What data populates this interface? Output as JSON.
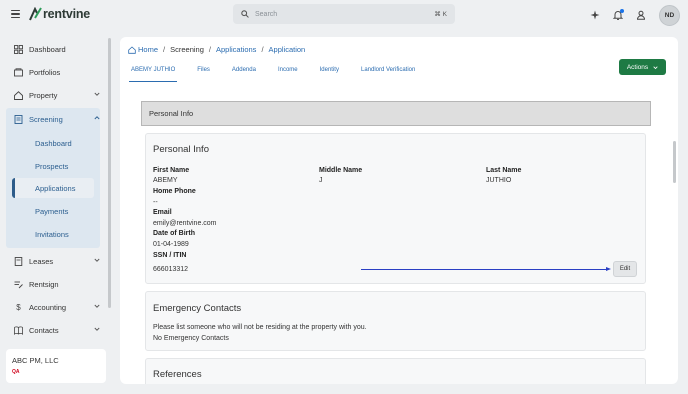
{
  "app": {
    "brand": "rentvine",
    "brand_color": "#2d3a35",
    "accent_color": "#2b6cb0",
    "primary_button_color": "#1e7a44"
  },
  "search": {
    "placeholder": "Search",
    "shortcut": "⌘ K"
  },
  "user": {
    "initials": "ND"
  },
  "sidebar": {
    "items": [
      {
        "label": "Dashboard",
        "icon": "dashboard-icon"
      },
      {
        "label": "Portfolios",
        "icon": "portfolio-icon"
      },
      {
        "label": "Property",
        "icon": "property-icon"
      },
      {
        "label": "Screening",
        "icon": "screening-icon"
      },
      {
        "label": "Leases",
        "icon": "lease-icon"
      },
      {
        "label": "Rentsign",
        "icon": "rentsign-icon"
      },
      {
        "label": "Accounting",
        "icon": "dollar-icon"
      },
      {
        "label": "Contacts",
        "icon": "contacts-icon"
      }
    ],
    "screening_sub": [
      "Dashboard",
      "Prospects",
      "Applications",
      "Payments",
      "Invitations"
    ],
    "active_sub": "Applications"
  },
  "company": {
    "name": "ABC PM, LLC",
    "tag": "QA"
  },
  "breadcrumb": {
    "home": "Home",
    "screening": "Screening",
    "applications": "Applications",
    "application": "Application"
  },
  "tabs": [
    "ABEMY JUTHIO",
    "Files",
    "Addenda",
    "Income",
    "Identity",
    "Landlord Verification"
  ],
  "actions_label": "Actions",
  "section_header": "Personal Info",
  "personal_info": {
    "title": "Personal Info",
    "first_name_label": "First Name",
    "first_name": "ABEMY",
    "middle_name_label": "Middle Name",
    "middle_name": "J",
    "last_name_label": "Last Name",
    "last_name": "JUTHIO",
    "home_phone_label": "Home Phone",
    "home_phone": "--",
    "email_label": "Email",
    "email": "emily@rentvine.com",
    "dob_label": "Date of Birth",
    "dob": "01-04-1989",
    "ssn_label": "SSN / ITIN",
    "ssn": "666013312",
    "edit_label": "Edit"
  },
  "emergency": {
    "title": "Emergency Contacts",
    "instructions": "Please list someone who will not be residing at the property with you.",
    "empty": "No Emergency Contacts"
  },
  "references": {
    "title": "References"
  }
}
